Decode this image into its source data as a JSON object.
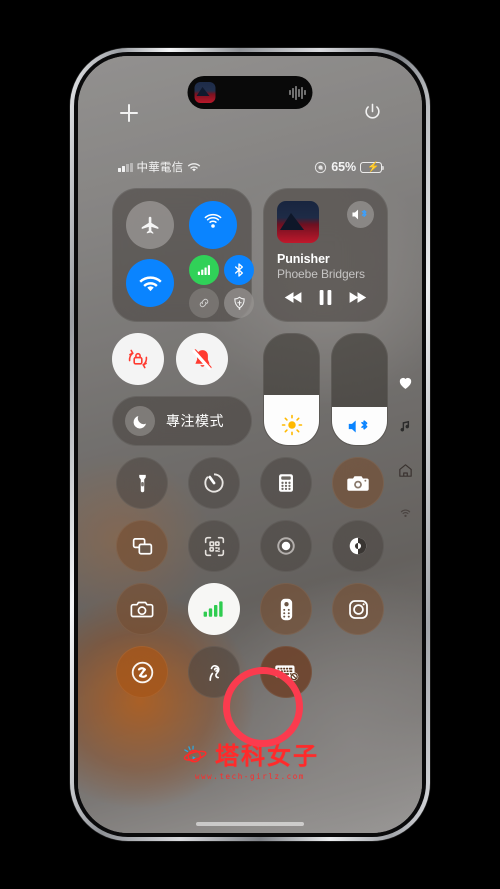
{
  "device": {
    "name": "iPhone 14 Pro",
    "frame_color": "#c9cbce",
    "screen": "Control Center"
  },
  "dynamic_island": {
    "now_playing_art": "album-art",
    "waveform_icon": "audio-waveform-icon",
    "siri_icon": "siri-orb-icon"
  },
  "top_icons": {
    "add_label": "+",
    "add_icon": "plus-icon",
    "power_icon": "power-icon"
  },
  "status_bar": {
    "signal_icon": "cellular-bars-icon",
    "carrier": "中華電信",
    "wifi_icon": "wifi-icon",
    "focus_icon": "focus-mode-icon",
    "battery_percent": "65%",
    "battery_level": 65,
    "battery_charging": true,
    "battery_color": "#32d74b"
  },
  "connectivity": {
    "airplane": {
      "label": "飛航模式",
      "icon": "airplane-icon",
      "active": false,
      "color": "#a09d9a"
    },
    "airdrop": {
      "label": "AirDrop",
      "icon": "airdrop-icon",
      "active": true,
      "color": "#0a84ff"
    },
    "wifi": {
      "label": "Wi-Fi",
      "icon": "wifi-icon",
      "active": true,
      "color": "#0a84ff"
    },
    "cellular": {
      "label": "行動數據",
      "icon": "cellular-data-icon",
      "active": true,
      "color": "#30d158"
    },
    "bluetooth": {
      "label": "藍牙",
      "icon": "bluetooth-icon",
      "active": true,
      "color": "#0a84ff"
    },
    "hotspot": {
      "label": "個人熱點",
      "icon": "hotspot-link-icon",
      "active": false,
      "color": "#827f7c"
    },
    "vpn": {
      "label": "VPN",
      "icon": "vpn-shield-icon",
      "active": false,
      "color": "#969390"
    }
  },
  "media": {
    "title": "Punisher",
    "artist": "Phoebe Bridgers",
    "album_art": "album-art-punisher",
    "route_icon": "airplay-bluetooth-speaker-icon",
    "prev_icon": "rewind-icon",
    "play_icon": "pause-icon",
    "next_icon": "fast-forward-icon",
    "is_playing": true
  },
  "toggles": {
    "rotation_lock": {
      "label": "旋轉鎖定",
      "icon": "rotation-lock-icon",
      "active": true,
      "color": "#ff3b30"
    },
    "silent_mode": {
      "label": "靜音模式",
      "icon": "bell-slash-icon",
      "active": true,
      "color": "#ff3b30"
    }
  },
  "focus": {
    "label": "專注模式",
    "icon": "moon-icon",
    "active": false
  },
  "sliders": {
    "brightness": {
      "label": "亮度",
      "icon": "sun-icon",
      "value": 45,
      "icon_color": "#ffb900"
    },
    "volume": {
      "label": "音量",
      "icon": "speaker-bluetooth-icon",
      "value": 34,
      "icon_color": "#0a84ff"
    }
  },
  "edge_icons": [
    {
      "name": "heart-icon",
      "label": "健康"
    },
    {
      "name": "music-note-icon",
      "label": "音樂"
    },
    {
      "name": "home-icon",
      "label": "家庭"
    },
    {
      "name": "airplay-icon",
      "label": "AirPlay"
    }
  ],
  "grid": [
    {
      "name": "flashlight-icon",
      "label": "手電筒",
      "style": "default"
    },
    {
      "name": "timer-icon",
      "label": "計時器",
      "style": "default"
    },
    {
      "name": "calculator-icon",
      "label": "計算機",
      "style": "default"
    },
    {
      "name": "camera-icon",
      "label": "相機",
      "style": "warm"
    },
    {
      "name": "screen-mirroring-icon",
      "label": "螢幕鏡像輸出",
      "style": "warm"
    },
    {
      "name": "qr-code-icon",
      "label": "掃描 QR Code",
      "style": "default"
    },
    {
      "name": "screen-record-icon",
      "label": "螢幕錄製",
      "style": "default"
    },
    {
      "name": "dark-mode-icon",
      "label": "深色模式",
      "style": "default"
    },
    {
      "name": "camera-outline-icon",
      "label": "相機",
      "style": "warm"
    },
    {
      "name": "cellular-signal-icon",
      "label": "行動訊號",
      "style": "light"
    },
    {
      "name": "apple-tv-remote-icon",
      "label": "Apple TV 遙控器",
      "style": "warm"
    },
    {
      "name": "instagram-icon",
      "label": "Instagram",
      "style": "warm"
    },
    {
      "name": "shazam-icon",
      "label": "音樂辨識",
      "style": "shaz"
    },
    {
      "name": "hearing-icon",
      "label": "聽力",
      "style": "default"
    },
    {
      "name": "keyboard-dismiss-icon",
      "label": "關閉鍵盤",
      "style": "kb",
      "highlighted": true
    }
  ],
  "annotation": {
    "shape": "circle",
    "color": "#fb3b4e",
    "target": "keyboard-dismiss-icon"
  },
  "watermark": {
    "text": "塔科女子",
    "url": "www.tech-girlz.com",
    "color": "#ff2a2a",
    "logo": "planet-logo"
  }
}
